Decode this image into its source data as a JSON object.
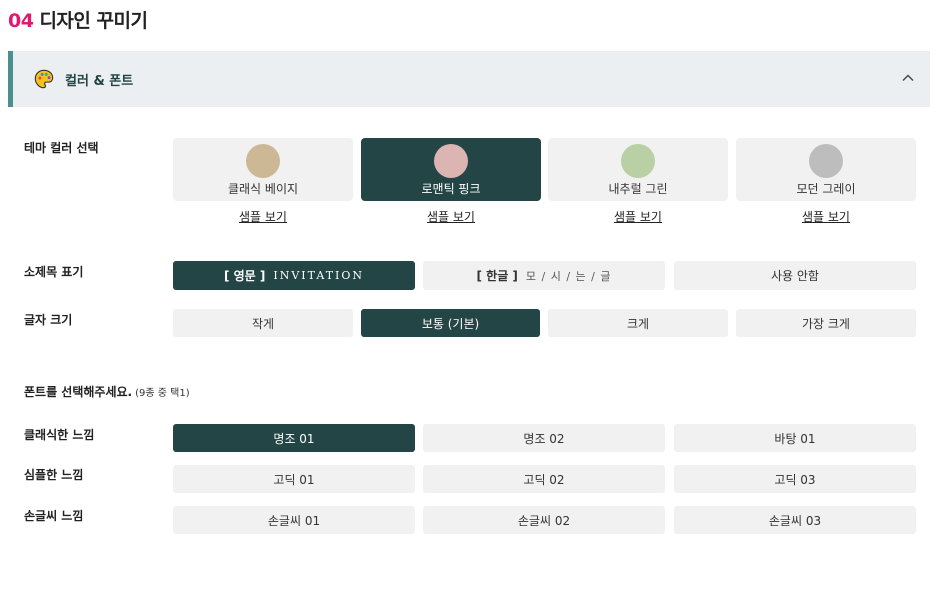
{
  "page": {
    "title_num": "04",
    "title": "디자인 꾸미기"
  },
  "section": {
    "label": "컬러 & 폰트",
    "icon": "palette-icon"
  },
  "theme": {
    "label": "테마 컬러 선택",
    "options": [
      {
        "name": "클래식 베이지",
        "color": "#cdb896",
        "selected": false,
        "sample": "샘플 보기"
      },
      {
        "name": "로맨틱 핑크",
        "color": "#dcb5b3",
        "selected": true,
        "sample": "샘플 보기"
      },
      {
        "name": "내추럴 그린",
        "color": "#b8d0a3",
        "selected": false,
        "sample": "샘플 보기"
      },
      {
        "name": "모던 그레이",
        "color": "#bdbdbd",
        "selected": false,
        "sample": "샘플 보기"
      }
    ]
  },
  "subtitle": {
    "label": "소제목 표기",
    "options": [
      {
        "tag": "[ 영문 ]",
        "text": "INVITATION",
        "selected": true
      },
      {
        "tag": "[ 한글 ]",
        "text": "모 / 시 / 는 / 글",
        "selected": false
      },
      {
        "tag": "",
        "text": "사용 안함",
        "selected": false
      }
    ]
  },
  "fontsize": {
    "label": "글자 크기",
    "options": [
      "작게",
      "보통 (기본)",
      "크게",
      "가장 크게"
    ],
    "selected_index": 1
  },
  "fonts": {
    "prompt": "폰트를 선택해주세요.",
    "prompt_sub": "(9종 중 택1)",
    "groups": [
      {
        "label": "클래식한 느낌",
        "options": [
          "명조 01",
          "명조 02",
          "바탕 01"
        ]
      },
      {
        "label": "심플한 느낌",
        "options": [
          "고딕 01",
          "고딕 02",
          "고딕 03"
        ]
      },
      {
        "label": "손글씨 느낌",
        "options": [
          "손글씨 01",
          "손글씨 02",
          "손글씨 03"
        ]
      }
    ],
    "selected": "명조 01"
  },
  "colors": {
    "accent": "#234545",
    "title_num": "#e0196e",
    "header_bar": "#4a918d"
  }
}
